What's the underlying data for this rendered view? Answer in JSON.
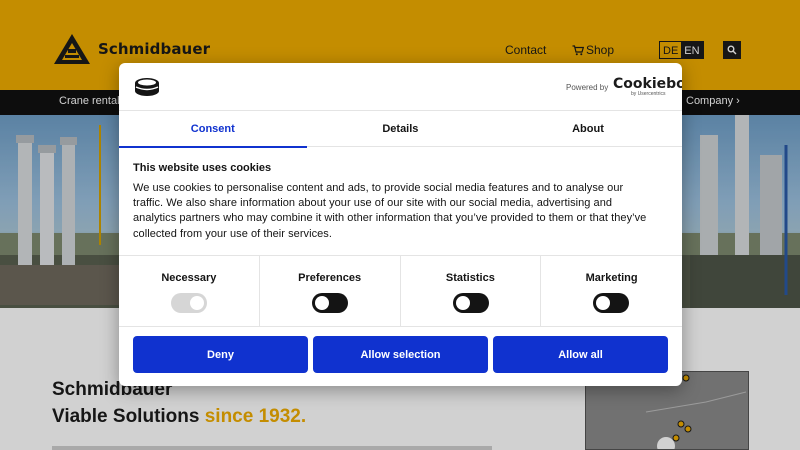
{
  "header": {
    "brand": "Schmidbauer",
    "nav": {
      "contact": "Contact",
      "shop": "Shop"
    },
    "lang": {
      "de": "DE",
      "en": "EN",
      "active": "EN"
    }
  },
  "menubar": {
    "left_item": "Crane rental",
    "right_item": "Company ›"
  },
  "page": {
    "headline_line1": "Schmidbauer",
    "headline_line2a": "Viable Solutions ",
    "headline_line2b": "since 1932."
  },
  "cookie_dialog": {
    "powered_by": "Powered by",
    "provider": "Cookiebot",
    "provider_sub": "by Usercentrics",
    "tabs": [
      {
        "label": "Consent",
        "active": true
      },
      {
        "label": "Details",
        "active": false
      },
      {
        "label": "About",
        "active": false
      }
    ],
    "title": "This website uses cookies",
    "text": "We use cookies to personalise content and ads, to provide social media features and to analyse our traffic. We also share information about your use of our site with our social media, advertising and analytics partners who may combine it with other information that you’ve provided to them or that they’ve collected from your use of their services.",
    "categories": [
      {
        "label": "Necessary",
        "state": "on-disabled"
      },
      {
        "label": "Preferences",
        "state": "off"
      },
      {
        "label": "Statistics",
        "state": "off"
      },
      {
        "label": "Marketing",
        "state": "off"
      }
    ],
    "buttons": {
      "deny": "Deny",
      "allow_selection": "Allow selection",
      "allow_all": "Allow all"
    }
  },
  "colors": {
    "brand_yellow": "#efac00",
    "accent_blue": "#1032cf",
    "dark": "#111111"
  },
  "icons": [
    "logo-mark",
    "cart-icon",
    "search-icon",
    "cookie-icon"
  ]
}
